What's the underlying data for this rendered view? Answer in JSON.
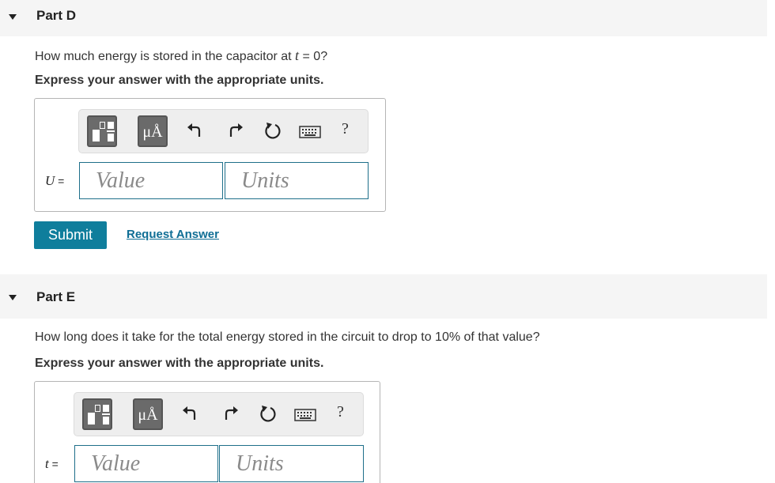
{
  "parts": [
    {
      "title": "Part D",
      "question_prefix": "How much energy is stored in the capacitor at ",
      "question_var": "t",
      "question_suffix": " = 0?",
      "instruction": "Express your answer with the appropriate units.",
      "var_symbol": "U",
      "var_eq": " =",
      "value_placeholder": "Value",
      "units_placeholder": "Units",
      "units_button": "μÅ",
      "help_label": "?",
      "submit_label": "Submit",
      "request_label": "Request Answer"
    },
    {
      "title": "Part E",
      "question": "How long does it take for the total energy stored in the circuit to drop to 10% of that value?",
      "instruction": "Express your answer with the appropriate units.",
      "var_symbol": "t",
      "var_eq": " =",
      "value_placeholder": "Value",
      "units_placeholder": "Units",
      "units_button": "μÅ",
      "help_label": "?"
    }
  ],
  "colors": {
    "accent": "#0f7e9c",
    "link": "#0f6e95",
    "header_bg": "#f5f5f5"
  },
  "icons": [
    "caret-down-icon",
    "templates-icon",
    "undo-icon",
    "redo-icon",
    "reset-icon",
    "keyboard-icon",
    "help-icon"
  ]
}
